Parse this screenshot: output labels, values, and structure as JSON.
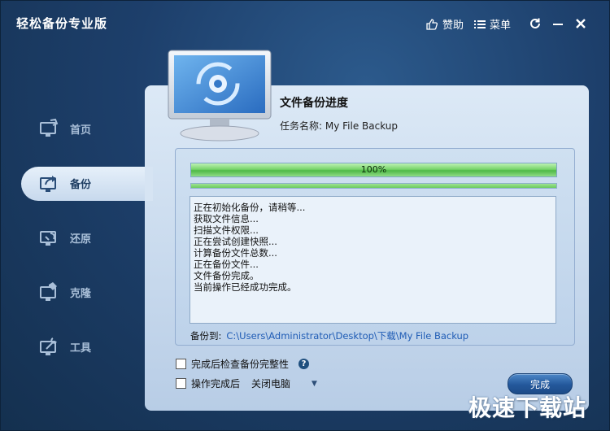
{
  "window": {
    "title": "轻松备份专业版",
    "like_label": "赞助",
    "menu_label": "菜单"
  },
  "sidebar": {
    "items": [
      {
        "label": "首页",
        "icon": "home-monitor-icon",
        "active": false
      },
      {
        "label": "备份",
        "icon": "backup-share-icon",
        "active": true
      },
      {
        "label": "还原",
        "icon": "restore-icon",
        "active": false
      },
      {
        "label": "克隆",
        "icon": "clone-icon",
        "active": false
      },
      {
        "label": "工具",
        "icon": "tools-icon",
        "active": false
      }
    ]
  },
  "header": {
    "title": "文件备份进度",
    "task_label": "任务名称:",
    "task_name": "My File Backup"
  },
  "progress": {
    "value": 1.0,
    "text": "100%"
  },
  "log": {
    "lines": [
      "正在初始化备份，请稍等...",
      "获取文件信息...",
      "扫描文件权限...",
      "正在尝试创建快照...",
      "计算备份文件总数...",
      "正在备份文件...",
      "文件备份完成。",
      "当前操作已经成功完成。"
    ]
  },
  "destination": {
    "label": "备份到:",
    "path": "C:\\Users\\Administrator\\Desktop\\下载\\My File Backup"
  },
  "options": {
    "verify_label": "完成后检查备份完整性",
    "after_label": "操作完成后",
    "after_value": "关闭电脑"
  },
  "buttons": {
    "finish": "完成"
  },
  "watermark": "极速下载站",
  "colors": {
    "background": "#1d3f6b",
    "panel": "#c9dbee",
    "accent": "#24589b",
    "progress_green": "#4fb947",
    "link": "#1f5cb5"
  }
}
